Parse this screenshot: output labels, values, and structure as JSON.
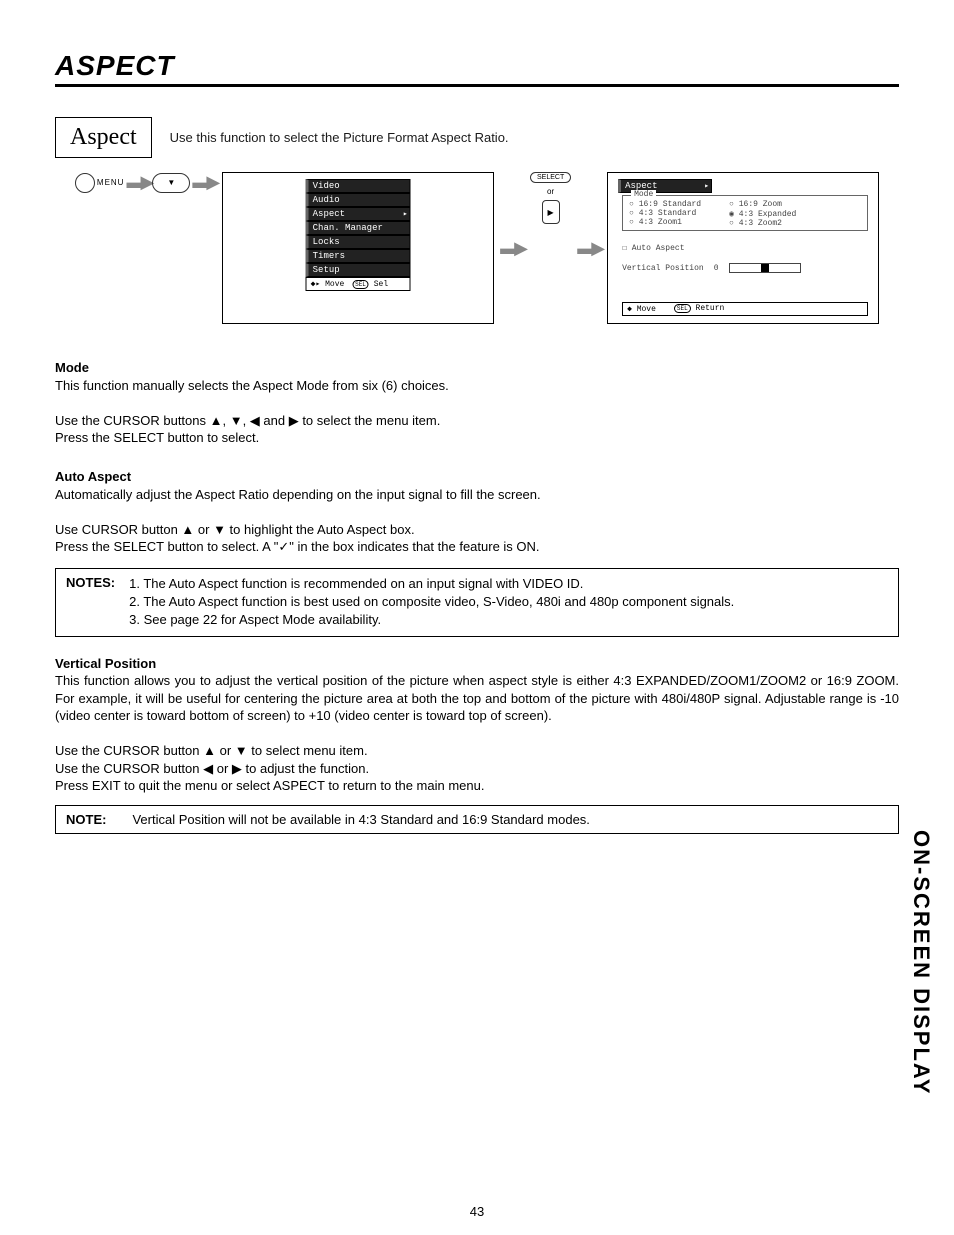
{
  "page": {
    "title": "ASPECT",
    "number": "43",
    "side_label": "ON-SCREEN DISPLAY"
  },
  "header": {
    "box_label": "Aspect",
    "desc": "Use this function to select the Picture Format Aspect Ratio."
  },
  "remote": {
    "menu": "MENU",
    "dpad": "▼",
    "select": "SELECT",
    "or": "or",
    "play": "▶"
  },
  "main_menu": {
    "items": [
      "Video",
      "Audio",
      "Aspect",
      "Chan. Manager",
      "Locks",
      "Timers",
      "Setup"
    ],
    "selected_index": 2,
    "footer_move": "Move",
    "footer_sel": "Sel",
    "footer_sel_btn": "SEL"
  },
  "aspect_menu": {
    "title": "Aspect",
    "mode_label": "Mode",
    "col1": [
      "16:9 Standard",
      "4:3 Standard",
      "4:3 Zoom1"
    ],
    "col2": [
      "16:9 Zoom",
      "4:3 Expanded",
      "4:3 Zoom2"
    ],
    "selected": "4:3 Expanded",
    "auto": "Auto Aspect",
    "vp_label": "Vertical Position",
    "vp_value": "0",
    "footer_move": "Move",
    "footer_return": "Return",
    "footer_sel_btn": "SEL"
  },
  "mode_section": {
    "heading": "Mode",
    "p1": "This function manually selects the Aspect Mode from six (6) choices.",
    "p2": "Use the CURSOR buttons ▲, ▼, ◀ and ▶ to select the menu item.",
    "p3": "Press the SELECT button to select."
  },
  "auto_section": {
    "heading": "Auto Aspect",
    "p1": "Automatically adjust the Aspect Ratio depending on the input signal to fill the screen.",
    "p2": "Use CURSOR button ▲ or ▼ to highlight the Auto Aspect box.",
    "p3": "Press the SELECT button to select. A \"✓\" in the box indicates that the feature is ON."
  },
  "notes1": {
    "label": "NOTES:",
    "l1": "1. The Auto Aspect function is recommended on an input signal with VIDEO ID.",
    "l2": "2. The Auto Aspect function is best used on composite video, S-Video, 480i and 480p component signals.",
    "l3": "3. See page 22 for Aspect Mode availability."
  },
  "vp_section": {
    "heading": "Vertical Position",
    "p1": "This function allows you to adjust the vertical position of the picture when aspect style is either 4:3 EXPANDED/ZOOM1/ZOOM2 or 16:9 ZOOM.  For example, it will be useful for centering the picture area at both the top and bottom of the picture with 480i/480P signal. Adjustable range is -10 (video center is toward bottom of screen) to +10 (video center is toward top of screen).",
    "p2": "Use the CURSOR button ▲ or ▼ to select menu item.",
    "p3": "Use the CURSOR button ◀ or ▶ to adjust the function.",
    "p4": "Press EXIT to quit the menu or select ASPECT to return to the main menu."
  },
  "note2": {
    "label": "NOTE:",
    "text": "Vertical Position will not be available in 4:3 Standard and 16:9 Standard modes."
  }
}
